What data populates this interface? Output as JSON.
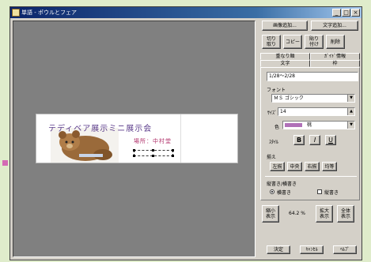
{
  "window": {
    "title": "単語 - ポウルとフェア",
    "controls": [
      "_",
      "□",
      "×"
    ]
  },
  "canvas": {
    "card_title": "テディベア展示ミニ展示会",
    "card_sub": "場所：中村堂"
  },
  "panel": {
    "top_buttons": {
      "add_image": "画像追加...",
      "add_text": "文字追加..."
    },
    "edit_buttons": [
      "切り\n取り",
      "コピー",
      "貼り\n付け",
      "削除"
    ],
    "tabs_row1": [
      "重なり順",
      "ｶﾞｲﾄﾞ情報"
    ],
    "tabs_row2": [
      "文字",
      "枠"
    ],
    "text_value": "1/28〜2/28",
    "font_label": "フォント",
    "font_value": "ＭＳ ゴシック",
    "size_label": "ｻｲｽﾞ",
    "size_value": "14",
    "color_label": "色",
    "color_value": "桃",
    "style_label": "ｽﾀｲﾙ",
    "style_buttons": [
      "B",
      "I",
      "U"
    ],
    "align_label": "揃え",
    "align_buttons": [
      "左揃",
      "中央",
      "右揃",
      "均等"
    ],
    "orientation_label": "縦書き/横書き",
    "orientation_options": [
      "横書き",
      "縦書き"
    ],
    "zoom_buttons": [
      "縮小\n表示",
      "拡大\n表示",
      "全体\n表示"
    ],
    "zoom_value": "64.2 %",
    "bottom_buttons": [
      "決定",
      "ｷｬﾝｾﾙ",
      "ﾍﾙﾌﾟ"
    ]
  },
  "colors": {
    "swatch": "#b070b8",
    "titlebar": "#0a246a",
    "background": "#dfeccb",
    "card_title": "#5a3a8a",
    "card_sub": "#b0306a"
  }
}
